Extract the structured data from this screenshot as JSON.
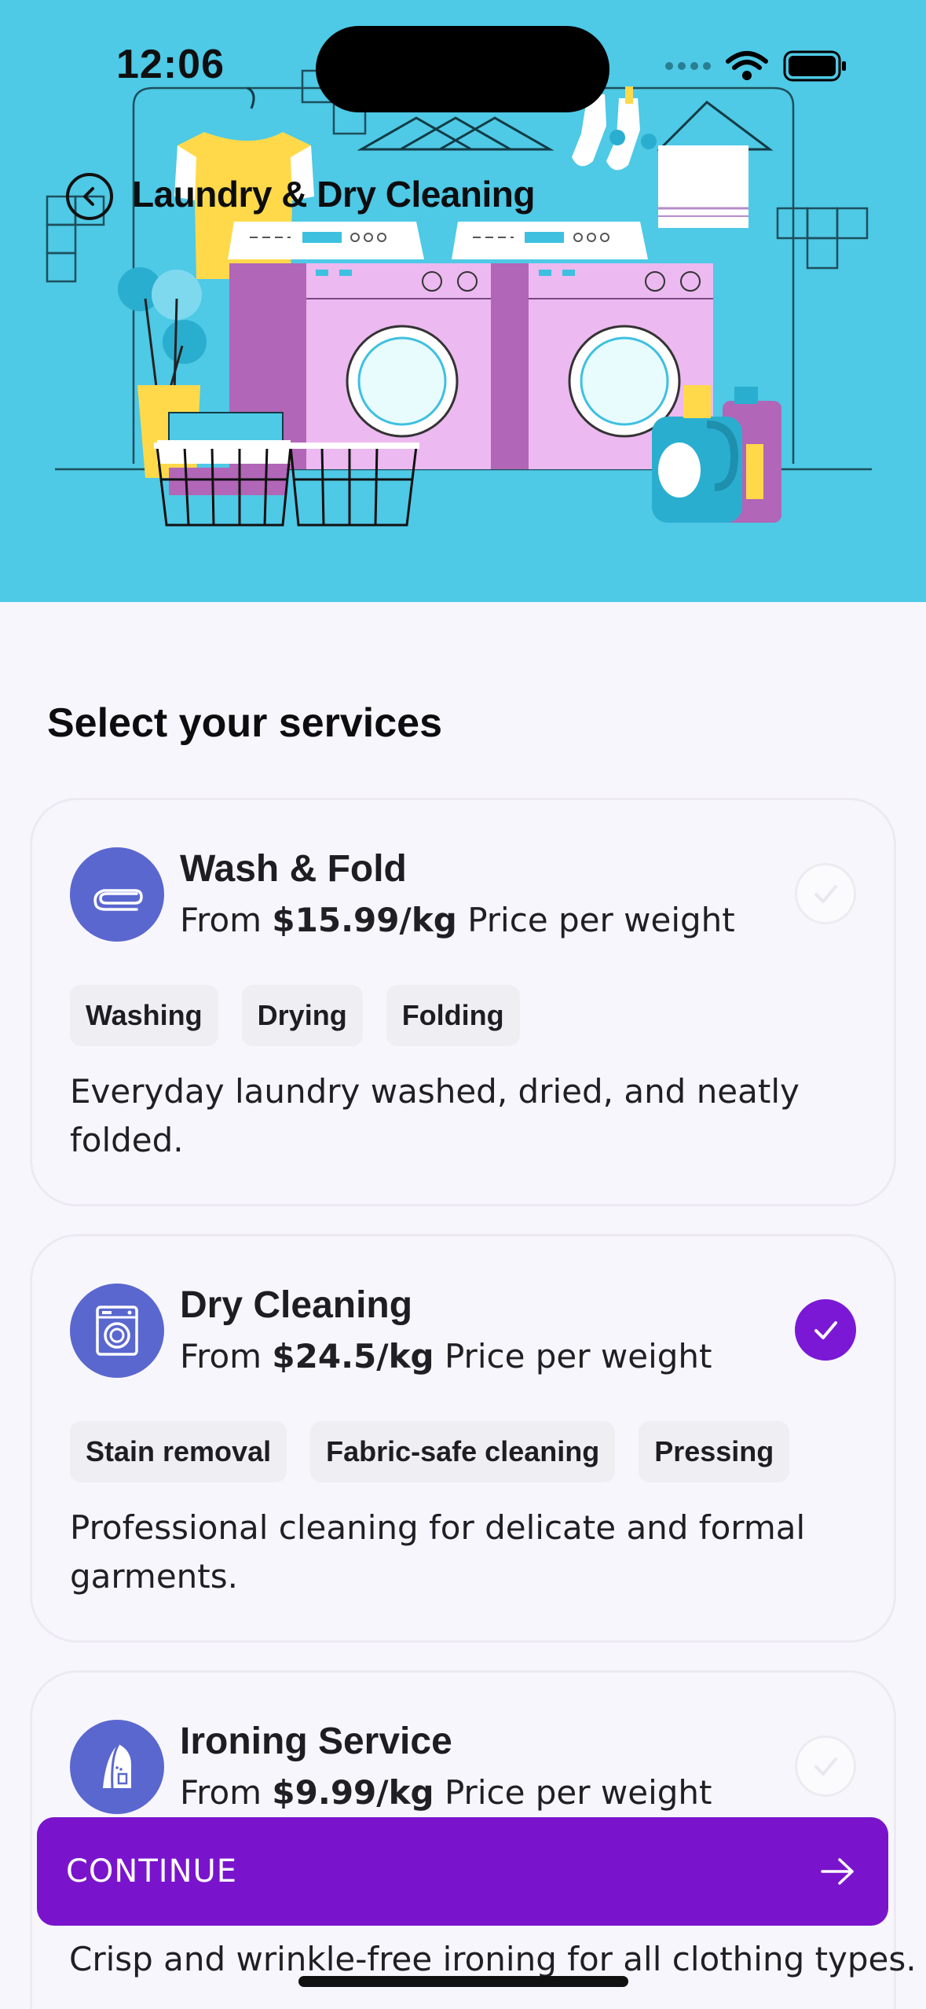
{
  "status": {
    "time": "12:06"
  },
  "header": {
    "title": "Laundry & Dry Cleaning"
  },
  "section": {
    "title": "Select your services"
  },
  "services": [
    {
      "name": "Wash & Fold",
      "price_prefix": "From",
      "price": "$15.99/kg",
      "price_suffix": "Price per weight",
      "tags": [
        "Washing",
        "Drying",
        "Folding"
      ],
      "description": "Everyday laundry washed, dried, and neatly folded.",
      "selected": false,
      "icon": "towel-icon"
    },
    {
      "name": "Dry Cleaning",
      "price_prefix": "From",
      "price": "$24.5/kg",
      "price_suffix": "Price per weight",
      "tags": [
        "Stain removal",
        "Fabric-safe cleaning",
        "Pressing"
      ],
      "description": "Professional cleaning for delicate and formal garments.",
      "selected": true,
      "icon": "washing-machine-icon"
    },
    {
      "name": "Ironing Service",
      "price_prefix": "From",
      "price": "$9.99/kg",
      "price_suffix": "Price per weight",
      "description": "Crisp and wrinkle-free ironing for all clothing types.",
      "selected": false,
      "icon": "iron-icon"
    }
  ],
  "continue_button": {
    "label": "CONTINUE"
  },
  "colors": {
    "hero_bg": "#4ec9e6",
    "accent": "#7a14cc",
    "service_icon_bg": "#5a67cf"
  }
}
